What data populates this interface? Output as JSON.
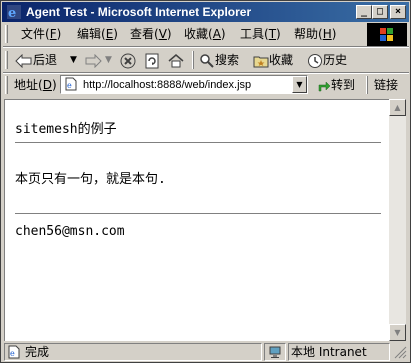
{
  "window": {
    "title": "Agent Test - Microsoft Internet Explorer"
  },
  "title_buttons": {
    "minimize": "_",
    "maximize": "□",
    "close": "×"
  },
  "menu": [
    {
      "label": "文件",
      "key": "F"
    },
    {
      "label": "编辑",
      "key": "E"
    },
    {
      "label": "查看",
      "key": "V"
    },
    {
      "label": "收藏",
      "key": "A"
    },
    {
      "label": "工具",
      "key": "T"
    },
    {
      "label": "帮助",
      "key": "H"
    }
  ],
  "toolbar": {
    "back": "后退",
    "search": "搜索",
    "favorites": "收藏",
    "history": "历史"
  },
  "address": {
    "label": "地址",
    "key": "D",
    "url": "http://localhost:8888/web/index.jsp",
    "go": "转到",
    "links": "链接"
  },
  "page": {
    "heading": "sitemesh的例子",
    "body": "本页只有一句，就是本句.",
    "footer": "chen56@msn.com"
  },
  "status": {
    "text": "完成",
    "zone": "本地 Intranet"
  },
  "colors": {
    "title_start": "#0a246a",
    "title_end": "#3a6ea5",
    "chrome": "#d4d0c8"
  }
}
